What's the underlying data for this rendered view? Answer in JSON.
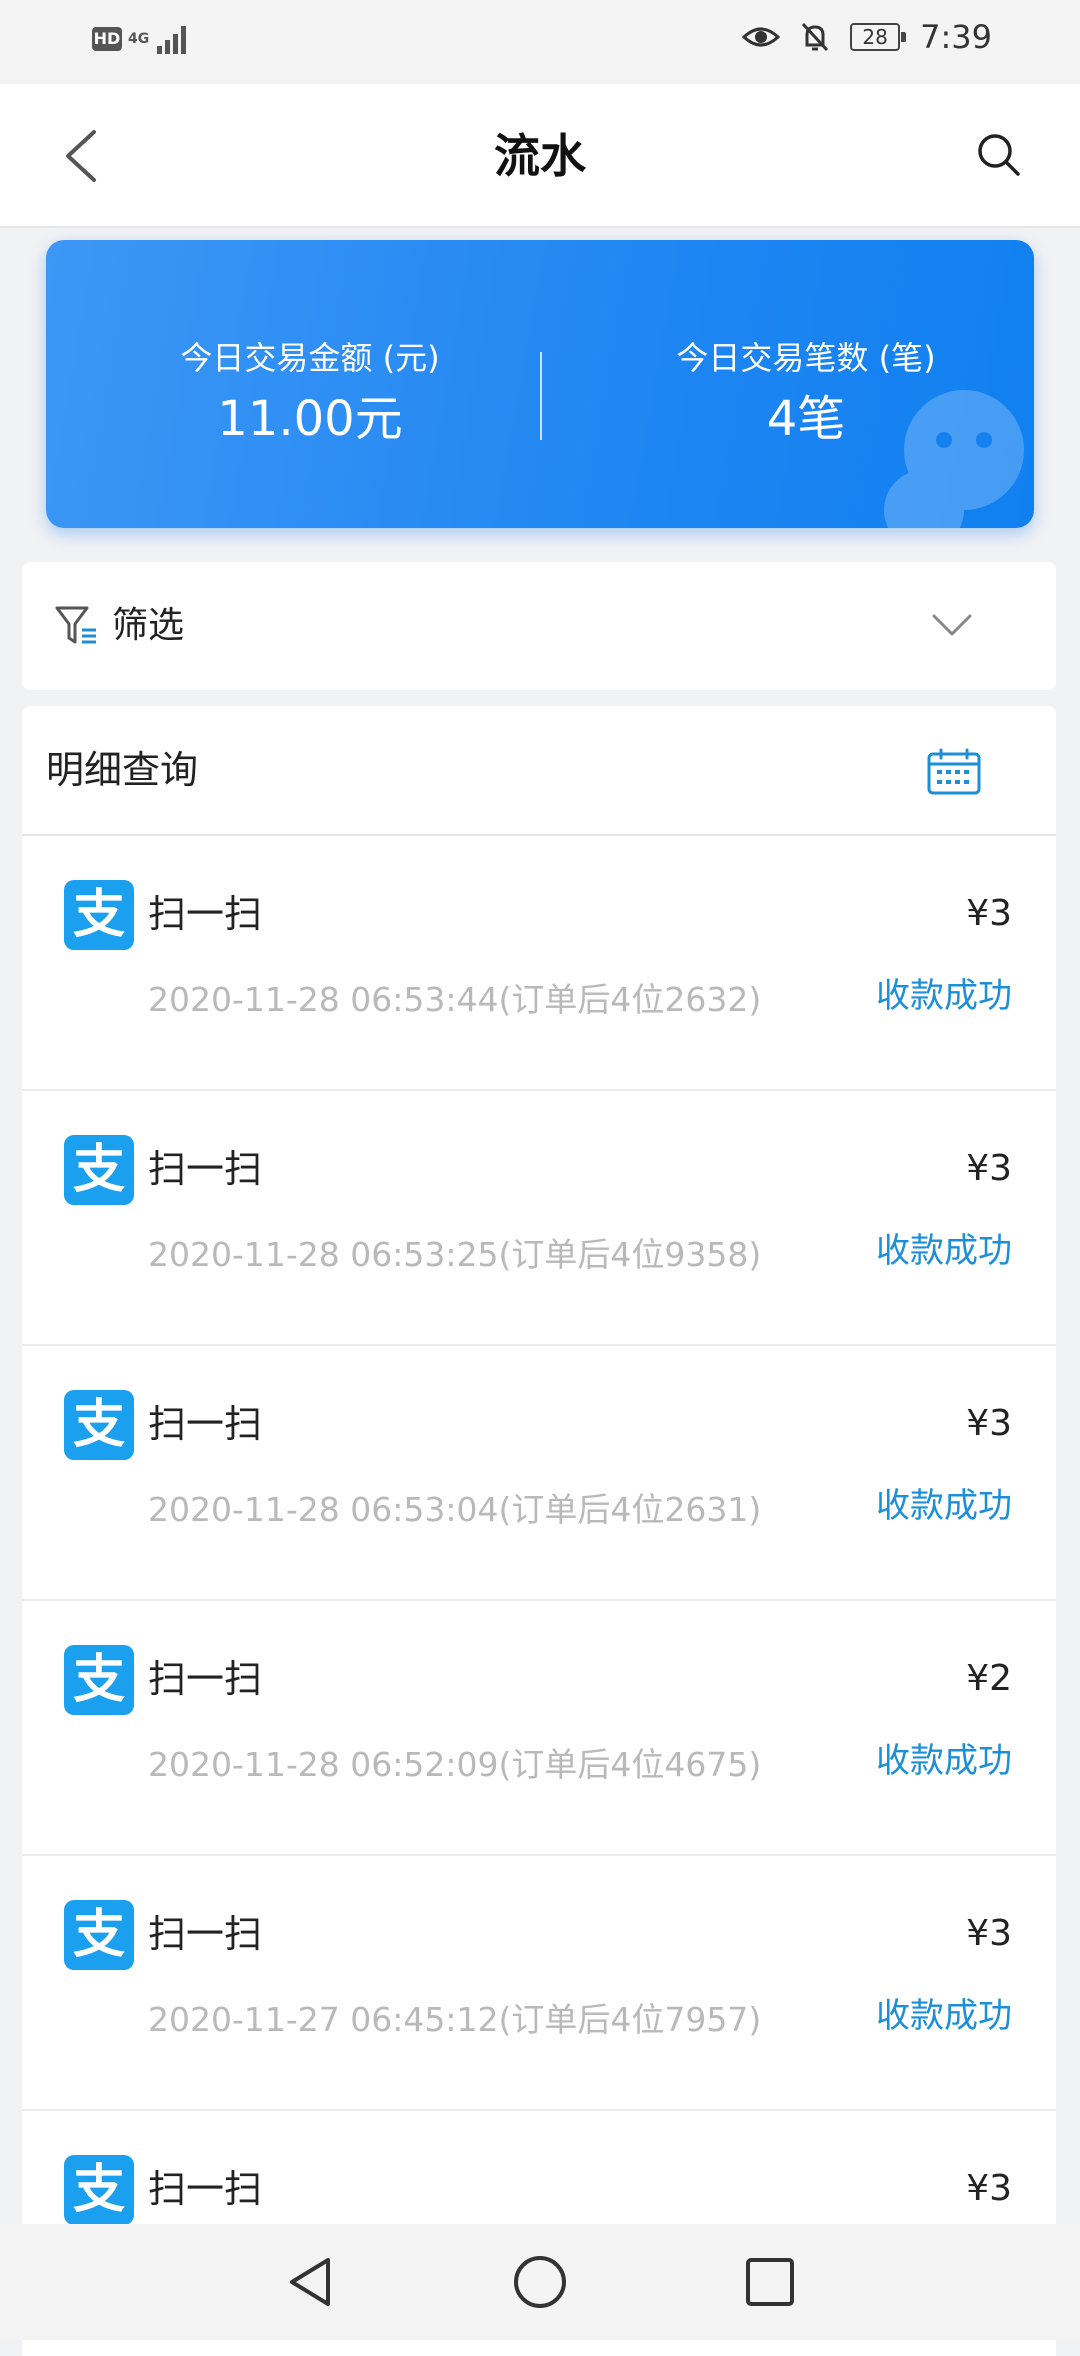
{
  "status_bar": {
    "hd": "HD",
    "network": "4G",
    "battery": "28",
    "time": "7:39"
  },
  "header": {
    "title": "流水"
  },
  "summary": {
    "amount_label": "今日交易金额 (元)",
    "amount_value": "11.00元",
    "count_label": "今日交易笔数 (笔)",
    "count_value": "4笔"
  },
  "filter": {
    "label": "筛选"
  },
  "detail": {
    "title": "明细查询",
    "rows": [
      {
        "name": "扫一扫",
        "amount": "¥3",
        "time": "2020-11-28  06:53:44(订单后4位2632)",
        "status": "收款成功"
      },
      {
        "name": "扫一扫",
        "amount": "¥3",
        "time": "2020-11-28  06:53:25(订单后4位9358)",
        "status": "收款成功"
      },
      {
        "name": "扫一扫",
        "amount": "¥3",
        "time": "2020-11-28  06:53:04(订单后4位2631)",
        "status": "收款成功"
      },
      {
        "name": "扫一扫",
        "amount": "¥2",
        "time": "2020-11-28  06:52:09(订单后4位4675)",
        "status": "收款成功"
      },
      {
        "name": "扫一扫",
        "amount": "¥3",
        "time": "2020-11-27  06:45:12(订单后4位7957)",
        "status": "收款成功"
      },
      {
        "name": "扫一扫",
        "amount": "¥3",
        "time": "",
        "status": ""
      }
    ],
    "logo_glyph": "支"
  },
  "colors": {
    "accent": "#1f86f2",
    "status": "#1c8fd8",
    "logo": "#1aa0ee"
  },
  "icons": [
    "back-arrow-icon",
    "search-icon",
    "filter-icon",
    "chevron-down-icon",
    "calendar-icon",
    "alipay-icon",
    "nav-back-icon",
    "nav-home-icon",
    "nav-recents-icon"
  ]
}
